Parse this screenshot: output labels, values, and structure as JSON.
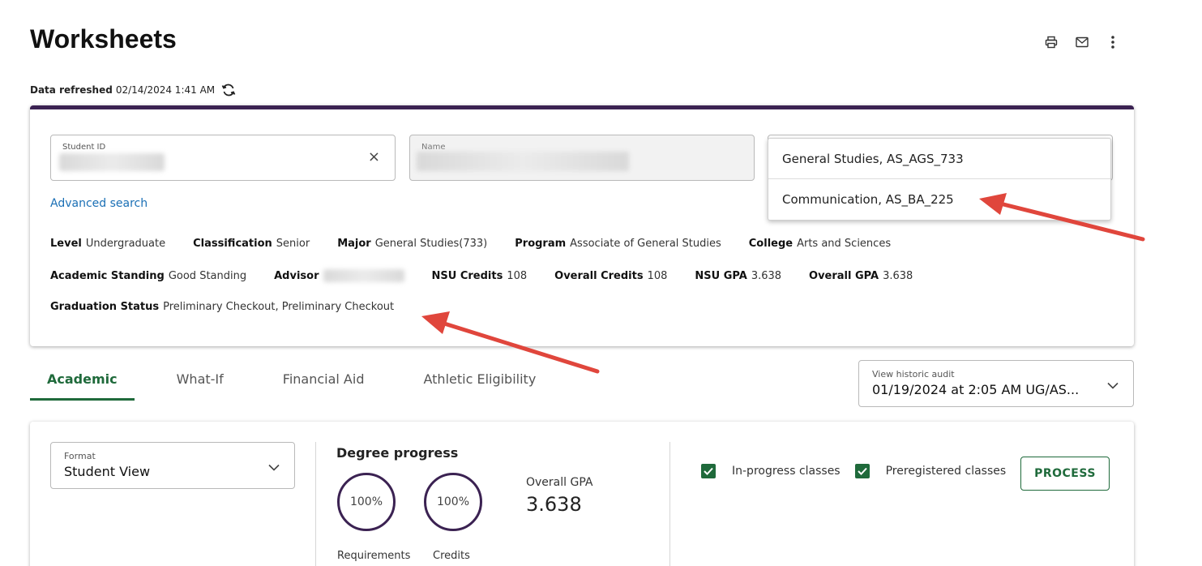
{
  "page": {
    "title": "Worksheets",
    "refresh_label": "Data refreshed",
    "refresh_time": "02/14/2024 1:41 AM"
  },
  "search": {
    "student_id_label": "Student ID",
    "name_label": "Name",
    "advanced_search": "Advanced search",
    "clear_icon": "×",
    "degree_options": [
      "General Studies, AS_AGS_733",
      "Communication, AS_BA_225"
    ]
  },
  "student": {
    "row1": [
      {
        "label": "Level",
        "value": "Undergraduate"
      },
      {
        "label": "Classification",
        "value": "Senior"
      },
      {
        "label": "Major",
        "value": "General Studies(733)"
      },
      {
        "label": "Program",
        "value": "Associate of General Studies"
      },
      {
        "label": "College",
        "value": "Arts and Sciences"
      }
    ],
    "row2": [
      {
        "label": "Academic Standing",
        "value": "Good Standing"
      },
      {
        "label": "Advisor",
        "value": ""
      },
      {
        "label": "NSU Credits",
        "value": "108"
      },
      {
        "label": "Overall Credits",
        "value": "108"
      },
      {
        "label": "NSU GPA",
        "value": "3.638"
      },
      {
        "label": "Overall GPA",
        "value": "3.638"
      }
    ],
    "row3": [
      {
        "label": "Graduation Status",
        "value": "Preliminary Checkout, Preliminary Checkout"
      }
    ]
  },
  "tabs": [
    "Academic",
    "What-If",
    "Financial Aid",
    "Athletic Eligibility"
  ],
  "historic": {
    "label": "View historic audit",
    "value": "01/19/2024 at 2:05 AM UG/AS..."
  },
  "audit": {
    "format_label": "Format",
    "format_value": "Student View",
    "progress_title": "Degree progress",
    "requirements_pct": "100%",
    "credits_pct": "100%",
    "requirements_label": "Requirements",
    "credits_label": "Credits",
    "gpa_label": "Overall GPA",
    "gpa_value": "3.638",
    "inprogress_label": "In-progress classes",
    "preregistered_label": "Preregistered classes",
    "process_label": "PROCESS"
  },
  "colors": {
    "accent": "#1f6a3b",
    "header_bar": "#3b2252",
    "link": "#1a6fb5",
    "annotation_arrow": "#e0463c"
  }
}
